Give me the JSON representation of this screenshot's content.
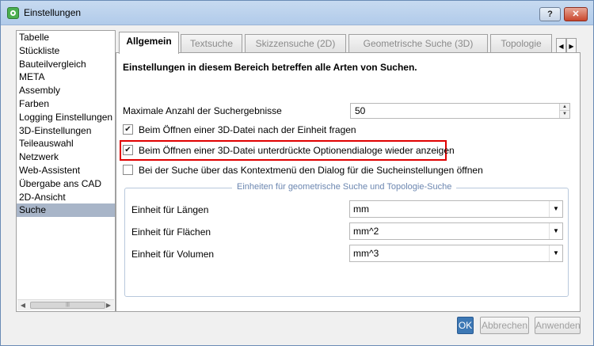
{
  "window": {
    "title": "Einstellungen",
    "help_label": "?",
    "close_label": "✕"
  },
  "sidebar": {
    "items": [
      "Tabelle",
      "Stückliste",
      "Bauteilvergleich",
      "META",
      "Assembly",
      "Farben",
      "Logging Einstellungen",
      "3D-Einstellungen",
      "Teileauswahl",
      "Netzwerk",
      "Web-Assistent",
      "Übergabe ans CAD",
      "2D-Ansicht",
      "Suche"
    ],
    "selected": "Suche"
  },
  "tabs": {
    "items": [
      "Allgemein",
      "Textsuche",
      "Skizzensuche (2D)",
      "Geometrische Suche (3D)",
      "Topologie"
    ],
    "active": "Allgemein",
    "scroll_left": "◀",
    "scroll_right": "▶"
  },
  "general": {
    "heading": "Einstellungen in diesem Bereich betreffen alle Arten von Suchen.",
    "max_results_label": "Maximale Anzahl der Suchergebnisse",
    "max_results_value": "50",
    "checkboxes": [
      {
        "label": "Beim Öffnen einer 3D-Datei nach der Einheit fragen",
        "checked": true
      },
      {
        "label": "Beim Öffnen einer 3D-Datei unterdrückte Optionendialoge wieder anzeigen",
        "checked": true
      },
      {
        "label": "Bei der Suche über das Kontextmenü den Dialog für die Sucheinstellungen öffnen",
        "checked": false
      }
    ]
  },
  "units_group": {
    "title": "Einheiten für geometrische Suche und Topologie-Suche",
    "rows": [
      {
        "label": "Einheit für Längen",
        "value": "mm"
      },
      {
        "label": "Einheit für Flächen",
        "value": "mm^2"
      },
      {
        "label": "Einheit für Volumen",
        "value": "mm^3"
      }
    ]
  },
  "buttons": {
    "ok": "OK",
    "cancel": "Abbrechen",
    "apply": "Anwenden"
  },
  "colors": {
    "highlight_border": "#e00000",
    "selected_item": "#a8b5c8",
    "ok_button": "#3d78b5"
  }
}
